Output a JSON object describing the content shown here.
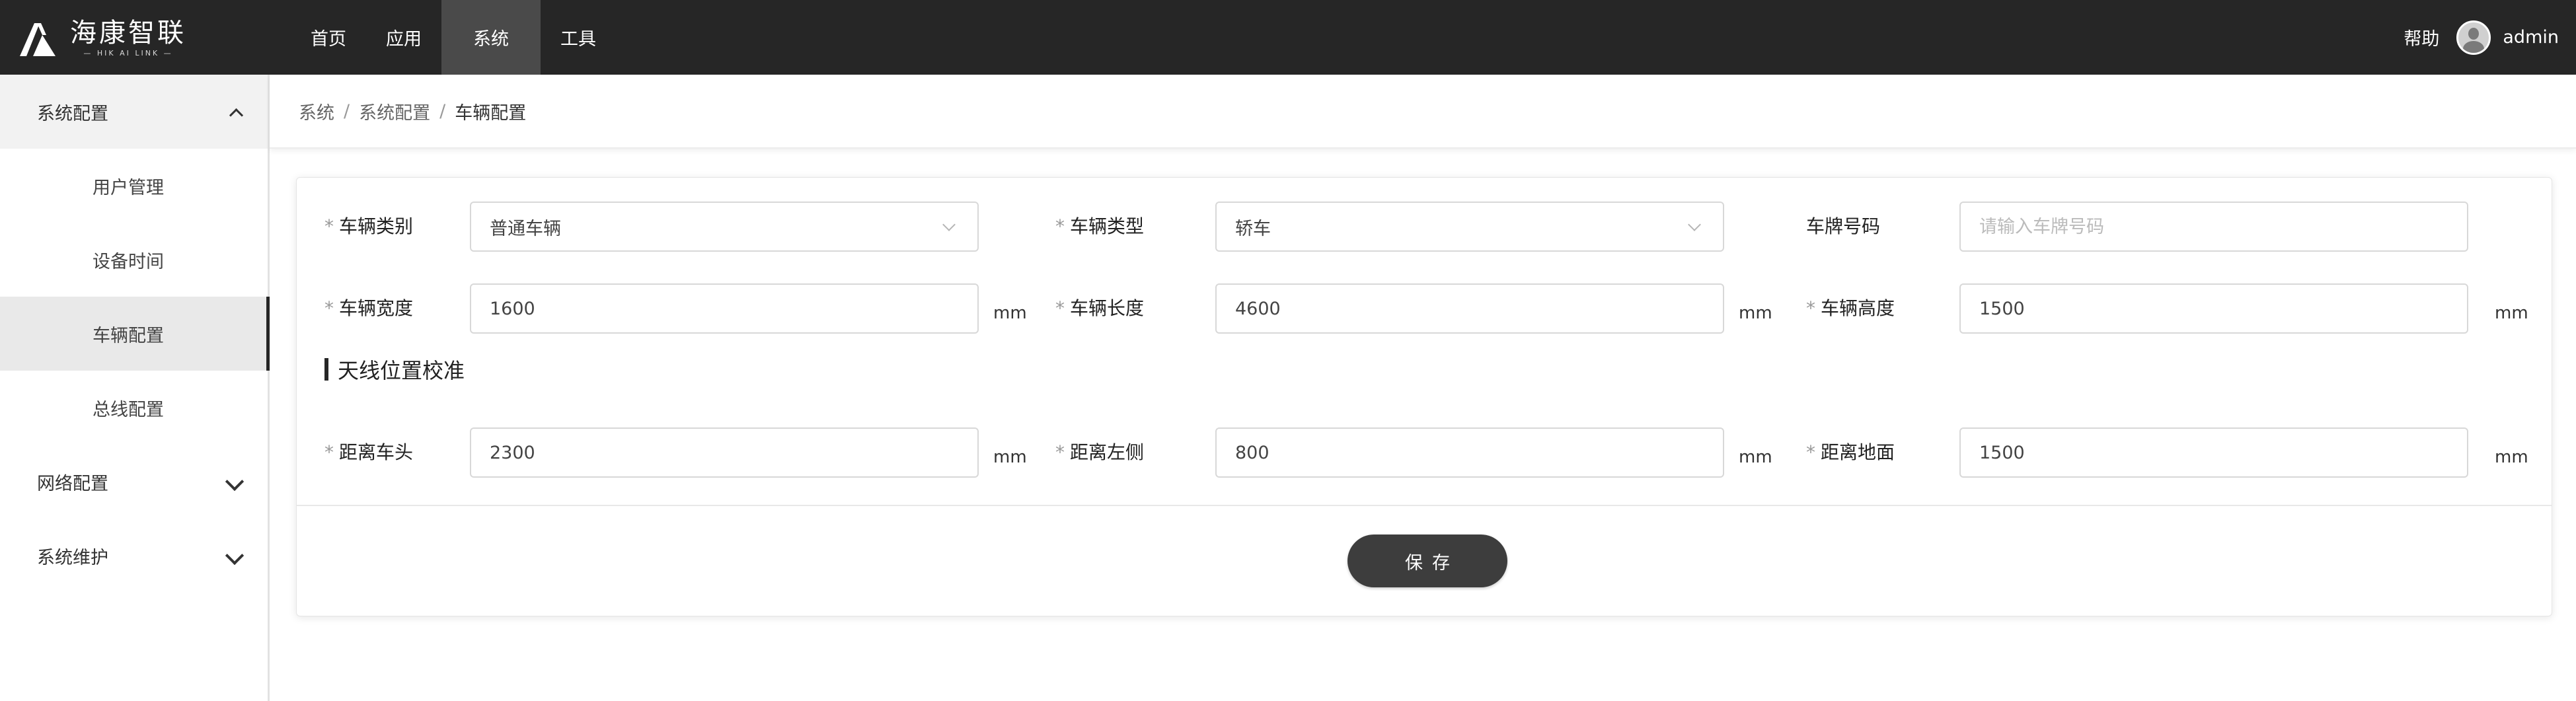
{
  "brand": {
    "name_cn": "海康智联",
    "name_en": "— HIK AI LINK —"
  },
  "topnav": {
    "items": [
      {
        "label": "首页"
      },
      {
        "label": "应用"
      },
      {
        "label": "系统"
      },
      {
        "label": "工具"
      }
    ],
    "active": "系统",
    "help_label": "帮助",
    "username": "admin"
  },
  "sidebar": {
    "groups": [
      {
        "label": "系统配置",
        "expanded": true,
        "items": [
          {
            "label": "用户管理"
          },
          {
            "label": "设备时间"
          },
          {
            "label": "车辆配置"
          },
          {
            "label": "总线配置"
          }
        ]
      },
      {
        "label": "网络配置",
        "expanded": false
      },
      {
        "label": "系统维护",
        "expanded": false
      }
    ],
    "active_item": "车辆配置"
  },
  "breadcrumb": {
    "items": [
      "系统",
      "系统配置",
      "车辆配置"
    ],
    "separator": "/"
  },
  "form": {
    "required_mark": "*",
    "vehicle_category": {
      "label": "车辆类别",
      "required": true,
      "value": "普通车辆"
    },
    "vehicle_type": {
      "label": "车辆类型",
      "required": true,
      "value": "轿车"
    },
    "plate_number": {
      "label": "车牌号码",
      "required": false,
      "value": "",
      "placeholder": "请输入车牌号码"
    },
    "vehicle_width": {
      "label": "车辆宽度",
      "required": true,
      "value": "1600",
      "unit": "mm"
    },
    "vehicle_length": {
      "label": "车辆长度",
      "required": true,
      "value": "4600",
      "unit": "mm"
    },
    "vehicle_height": {
      "label": "车辆高度",
      "required": true,
      "value": "1500",
      "unit": "mm"
    },
    "antenna_section_title": "天线位置校准",
    "distance_front": {
      "label": "距离车头",
      "required": true,
      "value": "2300",
      "unit": "mm"
    },
    "distance_left": {
      "label": "距离左侧",
      "required": true,
      "value": "800",
      "unit": "mm"
    },
    "distance_ground": {
      "label": "距离地面",
      "required": true,
      "value": "1500",
      "unit": "mm"
    },
    "save_label": "保存"
  },
  "colors": {
    "topbar_bg": "#262626",
    "nav_active_bg": "#4a4a4a",
    "save_button_bg": "#3d3d3d",
    "sidebar_active_bg": "#e9e9e9"
  }
}
